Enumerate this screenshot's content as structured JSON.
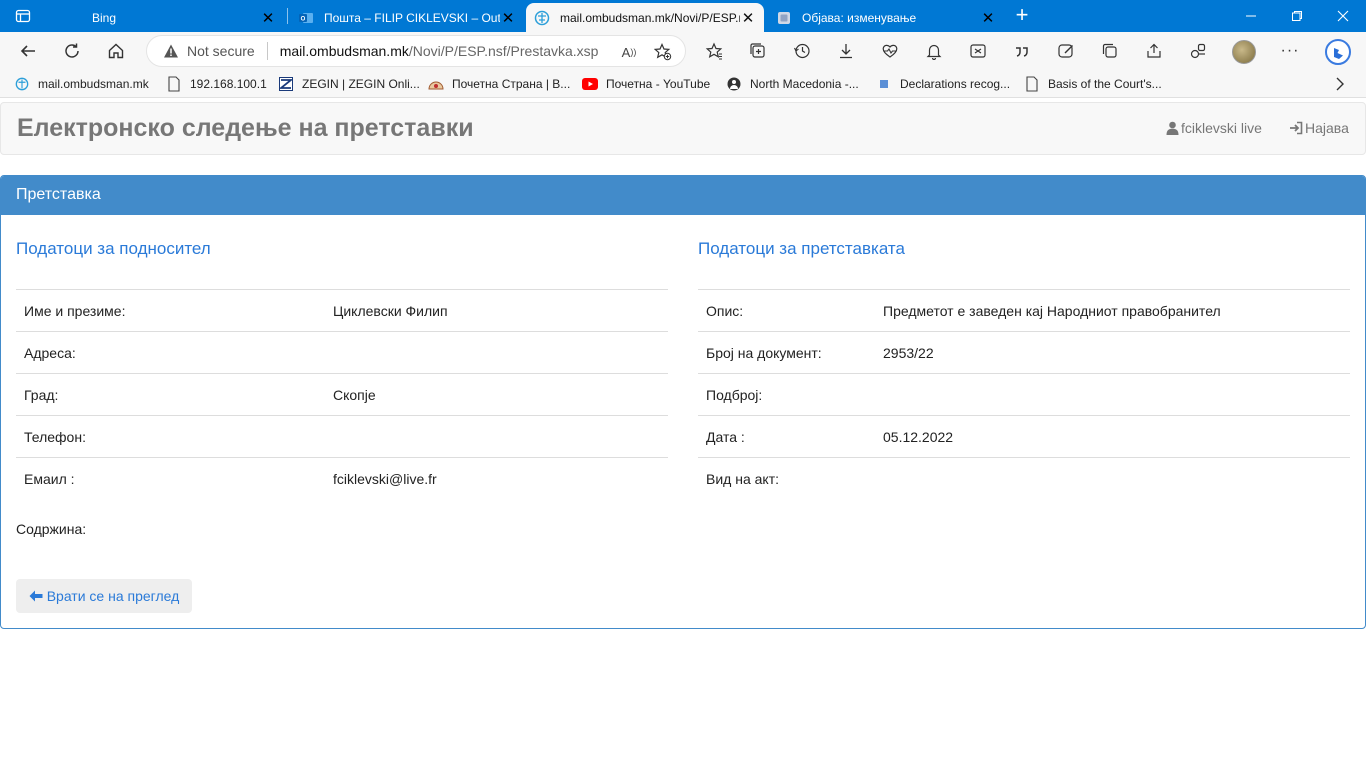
{
  "tabs": [
    {
      "title": "Bing",
      "active": false
    },
    {
      "title": "Пошта – FILIP CIKLEVSKI – Outlook",
      "active": false
    },
    {
      "title": "mail.ombudsman.mk/Novi/P/ESP.nsf",
      "active": true
    },
    {
      "title": "Објава: изменување",
      "active": false
    }
  ],
  "address": {
    "security_label": "Not secure",
    "host": "mail.ombudsman.mk",
    "path": "/Novi/P/ESP.nsf/Prestavka.xsp"
  },
  "favorites": [
    "mail.ombudsman.mk",
    "192.168.100.1",
    "ZEGIN | ZEGIN Onli...",
    "Почетна Страна | B...",
    "Почетна - YouTube",
    "North Macedonia -...",
    "Declarations recog...",
    "Basis of the Court's..."
  ],
  "page": {
    "brand": "Електронско следење на претставки",
    "user_link": "fciklevski live",
    "login_link": "Најава",
    "panel_title": "Претставка",
    "submitter_title": "Податоци за подносител",
    "petition_title": "Податоци за претставката",
    "submitter_rows": [
      {
        "label": "Име и презиме:",
        "value": "Циклевски Филип"
      },
      {
        "label": "Адреса:",
        "value": ""
      },
      {
        "label": "Град:",
        "value": "Скопје"
      },
      {
        "label": "Телефон:",
        "value": ""
      },
      {
        "label": "Емаил :",
        "value": "fciklevski@live.fr"
      }
    ],
    "petition_rows": [
      {
        "label": "Опис:",
        "value": "Предметот е заведен кај Народниот правобранител"
      },
      {
        "label": "Број на документ:",
        "value": "2953/22"
      },
      {
        "label": "Подброј:",
        "value": ""
      },
      {
        "label": "Дата :",
        "value": "05.12.2022"
      },
      {
        "label": "Вид на акт:",
        "value": ""
      }
    ],
    "content_label": "Содржина:",
    "back_button": "Врати се на преглед"
  },
  "colors": {
    "browser_accent": "#0078d4",
    "panel_primary": "#428bca",
    "link_blue": "#2a7ad8"
  }
}
